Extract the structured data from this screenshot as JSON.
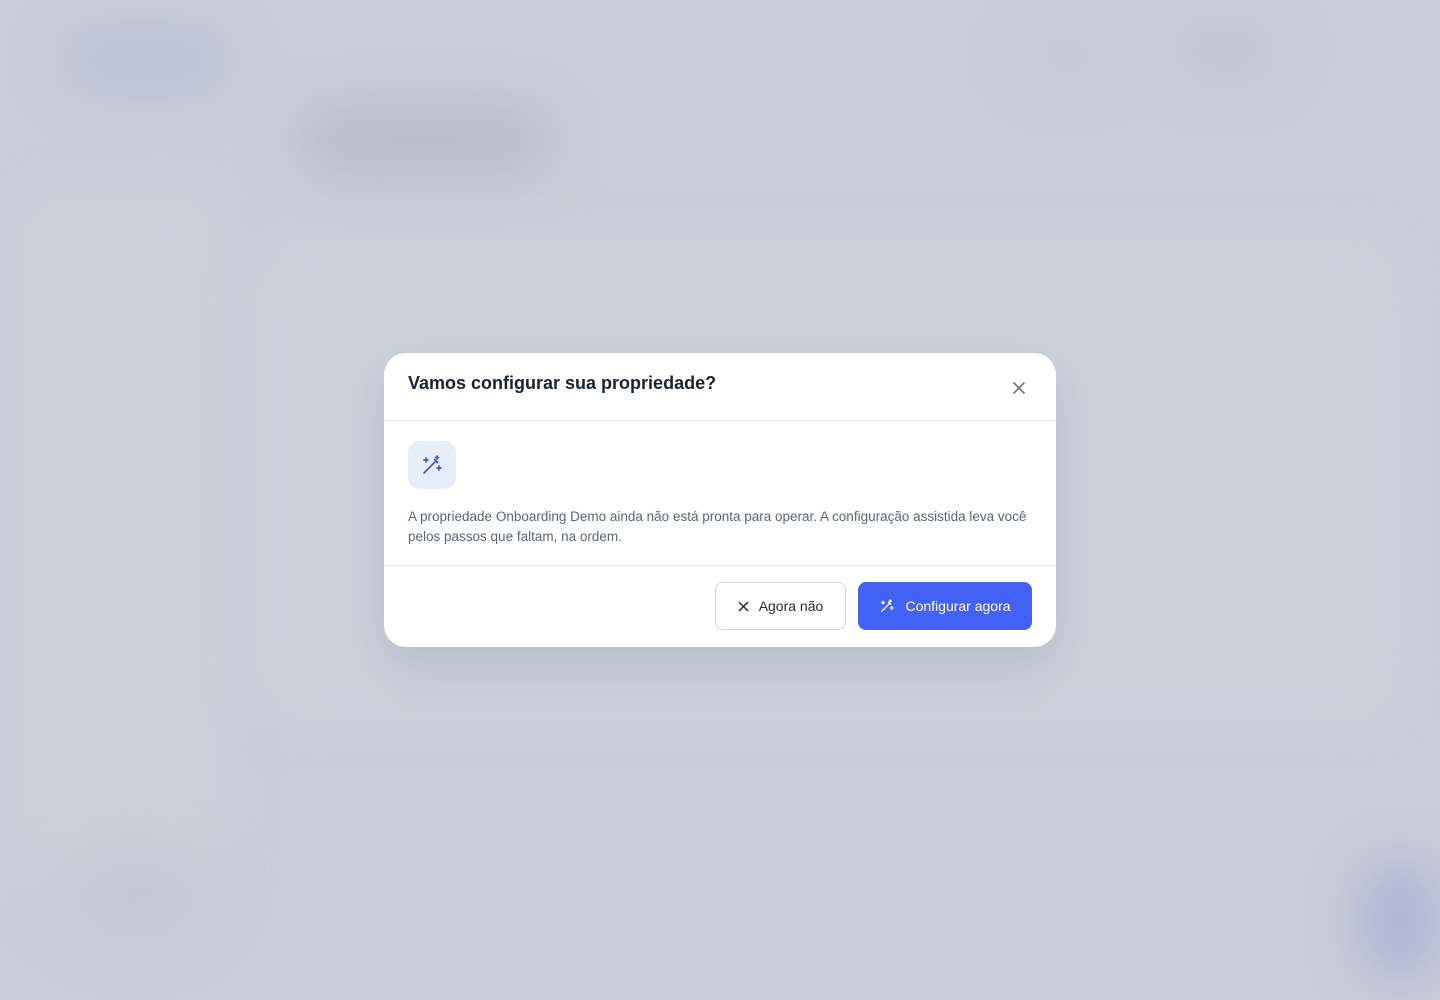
{
  "modal": {
    "title": "Vamos configurar sua propriedade?",
    "description": "A propriedade Onboarding Demo ainda não está pronta para operar. A configuração assistida leva você pelos passos que faltam, na ordem.",
    "close_icon": "close-icon",
    "hero_icon": "magic-wand-icon"
  },
  "actions": {
    "dismiss_label": "Agora não",
    "dismiss_icon": "close-icon",
    "confirm_label": "Configurar agora",
    "confirm_icon": "magic-wand-icon"
  },
  "colors": {
    "primary": "#4361f5",
    "backdrop": "#c9ced8",
    "title": "#1b2035",
    "text": "#5c6477",
    "icon_tile": "#e9edfb"
  }
}
